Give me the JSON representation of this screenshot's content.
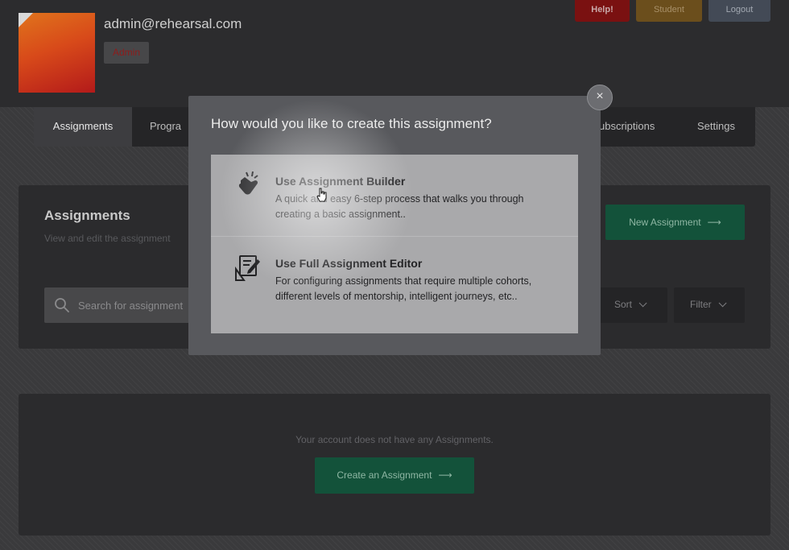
{
  "header": {
    "user_email": "admin@rehearsal.com",
    "role_badge": "Admin",
    "help_label": "Help!",
    "student_label": "Student",
    "logout_label": "Logout"
  },
  "nav": {
    "assignments": "Assignments",
    "programs": "Progra",
    "subscriptions": "ubscriptions",
    "settings": "Settings"
  },
  "assignments_panel": {
    "title": "Assignments",
    "subtitle": "View and edit the assignment",
    "new_label": "New Assignment",
    "search_placeholder": "Search for assignment",
    "sort_label": "Sort",
    "filter_label": "Filter"
  },
  "empty_panel": {
    "message": "Your account does not have any Assignments.",
    "create_label": "Create an Assignment"
  },
  "modal": {
    "title": "How would you like to create this assignment?",
    "option_builder": {
      "title": "Use Assignment Builder",
      "description": "A quick and easy 6-step process that walks you through creating a basic assignment.."
    },
    "option_editor": {
      "title": "Use Full Assignment Editor",
      "description": "For configuring assignments that require multiple cohorts, different levels of mentorship, intelligent journeys, etc.."
    },
    "close_symbol": "×"
  },
  "glyphs": {
    "arrow": "⟶"
  },
  "icons": [
    "search-icon",
    "snap-hand-icon",
    "edit-document-icon",
    "close-icon",
    "chevron-down-icon",
    "arrow-right-icon",
    "pointer-cursor-icon"
  ]
}
